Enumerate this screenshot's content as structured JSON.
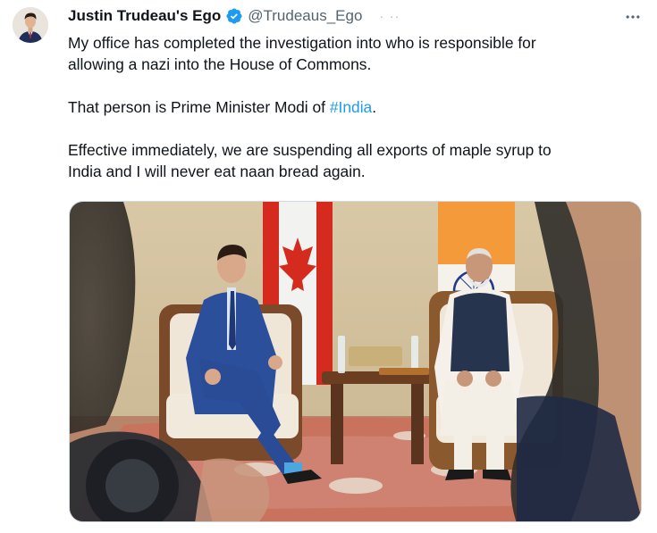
{
  "author": {
    "display_name": "Justin Trudeau's Ego",
    "handle": "@Trudeaus_Ego",
    "verified": true,
    "header_fade": "· ··"
  },
  "tweet": {
    "line1": "My office has completed the investigation into who is responsible for",
    "line2": "allowing a nazi into the House of Commons.",
    "line3_prefix": "That person is Prime Minister Modi of ",
    "hashtag": "#India",
    "line3_suffix": ".",
    "line4": "Effective immediately, we are suspending all exports of maple syrup to",
    "line5": "India and I will never eat naan bread again."
  },
  "icons": {
    "more": "more-horizontal-icon",
    "verified": "verified-badge-icon"
  },
  "colors": {
    "text": "#0f1419",
    "secondary": "#536471",
    "link": "#1d9bf0",
    "border": "#cfd9de"
  }
}
